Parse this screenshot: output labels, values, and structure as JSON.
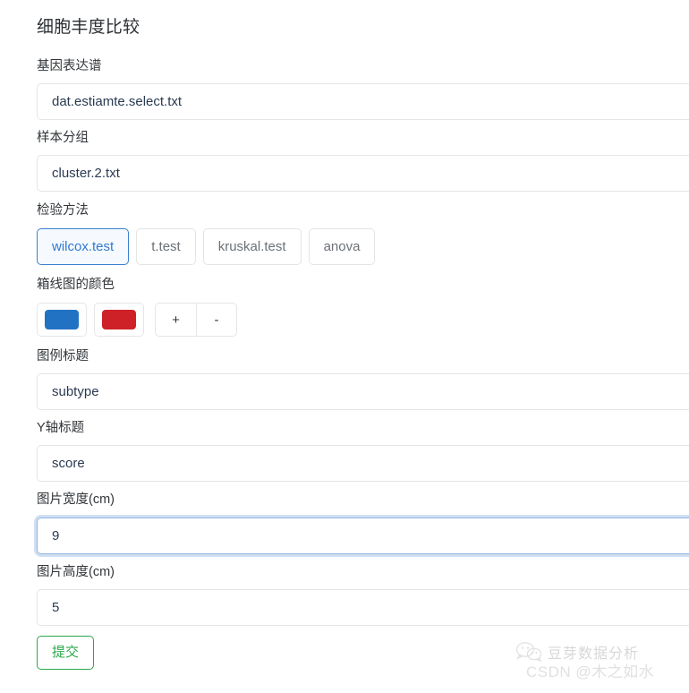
{
  "page": {
    "title": "细胞丰度比较"
  },
  "fields": {
    "expression_profile": {
      "label": "基因表达谱",
      "value": "dat.estiamte.select.txt",
      "placeholder": "dat.estiamte.select.txt"
    },
    "sample_group": {
      "label": "样本分组",
      "value": "cluster.2.txt",
      "placeholder": "cluster.2.txt"
    },
    "test_method": {
      "label": "检验方法",
      "options": [
        "wilcox.test",
        "t.test",
        "kruskal.test",
        "anova"
      ],
      "selected": "wilcox.test"
    },
    "boxplot_colors": {
      "label": "箱线图的颜色",
      "swatches": [
        "#2272c4",
        "#cd2127"
      ],
      "add_label": "+",
      "remove_label": "-"
    },
    "legend_title": {
      "label": "图例标题",
      "value": "subtype",
      "placeholder": "subtype"
    },
    "y_axis_title": {
      "label": "Y轴标题",
      "value": "score",
      "placeholder": "score"
    },
    "image_width": {
      "label": "图片宽度(cm)",
      "value": "9",
      "placeholder": "9",
      "focused": true
    },
    "image_height": {
      "label": "图片高度(cm)",
      "value": "5",
      "placeholder": "5"
    }
  },
  "submit": {
    "label": "提交"
  },
  "watermark": {
    "icon": "wechat-icon",
    "brand": "豆芽数据分析",
    "credit": "CSDN @木之如水"
  },
  "colors": {
    "accent_blue": "#3079cd",
    "swatch_blue": "#2272c4",
    "swatch_red": "#cd2127",
    "submit_green": "#2aa84a",
    "text_dark": "#2b3a52",
    "label": "#32363a",
    "border": "#e3e5e8"
  }
}
